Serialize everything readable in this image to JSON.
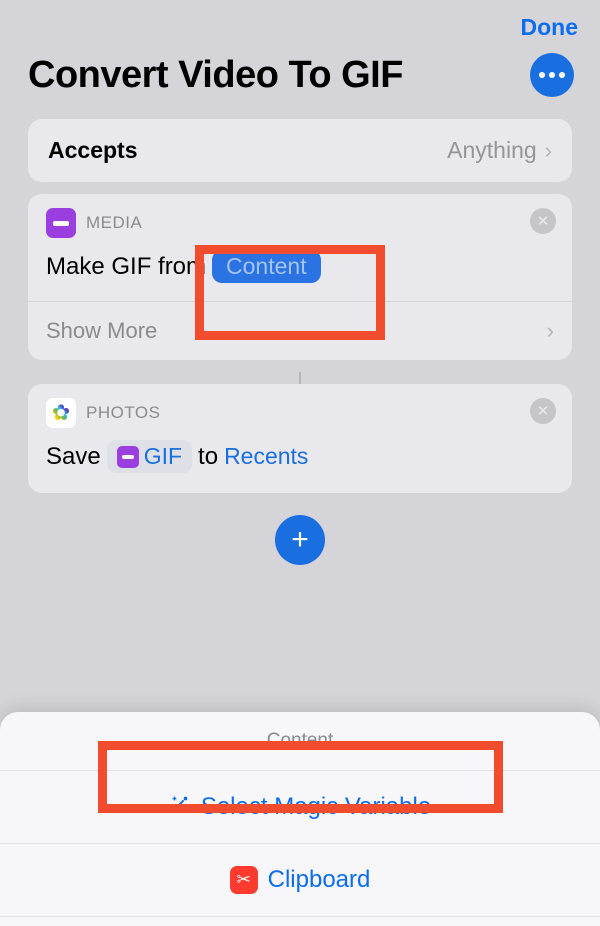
{
  "header": {
    "done_label": "Done",
    "title": "Convert Video To GIF",
    "more_icon": "ellipsis-icon"
  },
  "accepts": {
    "label": "Accepts",
    "value": "Anything"
  },
  "actions": [
    {
      "category": "MEDIA",
      "icon": "media-icon",
      "text_prefix": "Make GIF from",
      "variable_token": "Content",
      "show_more_label": "Show More"
    },
    {
      "category": "PHOTOS",
      "icon": "photos-icon",
      "text_prefix": "Save",
      "variable_pill": "GIF",
      "text_middle": "to",
      "destination": "Recents"
    }
  ],
  "add_button_icon": "plus-icon",
  "sheet": {
    "title": "Content",
    "options": [
      {
        "icon": "wand-icon",
        "label": "Select Magic Variable"
      },
      {
        "icon": "scissors-icon",
        "label": "Clipboard"
      }
    ]
  }
}
